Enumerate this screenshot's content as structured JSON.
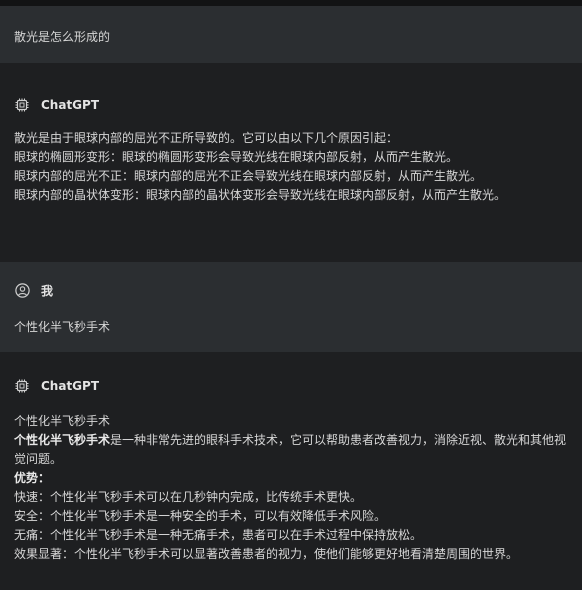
{
  "conversation": {
    "q1": {
      "text": "散光是怎么形成的"
    },
    "a1": {
      "author": "ChatGPT",
      "author_icon": "chip-icon",
      "lines": [
        "散光是由于眼球内部的屈光不正所导致的。它可以由以下几个原因引起：",
        "眼球的椭圆形变形：眼球的椭圆形变形会导致光线在眼球内部反射，从而产生散光。",
        "眼球内部的屈光不正：眼球内部的屈光不正会导致光线在眼球内部反射，从而产生散光。",
        "眼球内部的晶状体变形：眼球内部的晶状体变形会导致光线在眼球内部反射，从而产生散光。"
      ]
    },
    "u2": {
      "author": "我",
      "author_icon": "user-icon",
      "text": "个性化半飞秒手术"
    },
    "a2": {
      "author": "ChatGPT",
      "author_icon": "chip-icon",
      "title": "个性化半飞秒手术",
      "intro_bold": "个性化半飞秒手术",
      "intro_rest": "是一种非常先进的眼科手术技术，它可以帮助患者改善视力，消除近视、散光和其他视觉问题。",
      "advantages_label": "优势：",
      "advantages": [
        "快速：个性化半飞秒手术可以在几秒钟内完成，比传统手术更快。",
        "安全：个性化半飞秒手术是一种安全的手术，可以有效降低手术风险。",
        "无痛：个性化半飞秒手术是一种无痛手术，患者可以在手术过程中保持放松。",
        "效果显著：个性化半飞秒手术可以显著改善患者的视力，使他们能够更好地看清楚周围的世界。"
      ]
    }
  },
  "colors": {
    "user_bg": "#2b2e31",
    "ai_bg": "#1e1f21",
    "text": "#d6d6d6"
  }
}
